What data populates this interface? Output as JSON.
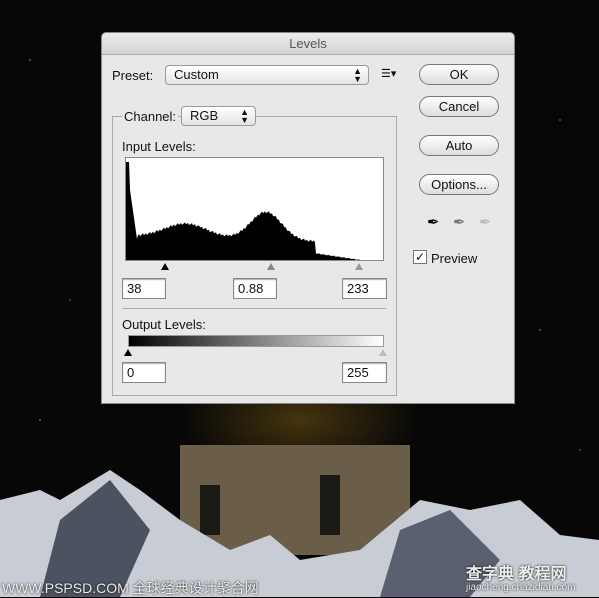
{
  "dialog": {
    "title": "Levels",
    "preset_label": "Preset:",
    "preset_value": "Custom",
    "channel_label": "Channel:",
    "channel_value": "RGB",
    "input_levels_label": "Input Levels:",
    "input_black": "38",
    "input_gamma": "0.88",
    "input_white": "233",
    "output_levels_label": "Output Levels:",
    "output_black": "0",
    "output_white": "255",
    "buttons": {
      "ok": "OK",
      "cancel": "Cancel",
      "auto": "Auto",
      "options": "Options..."
    },
    "preview_label": "Preview",
    "preview_checked": true
  },
  "watermarks": {
    "left": "WWW.PSPSD.COM 全球经典设计聚合网",
    "right_logo": "查字典 教程网",
    "right_url": "jiaocheng.chazidian.com"
  }
}
